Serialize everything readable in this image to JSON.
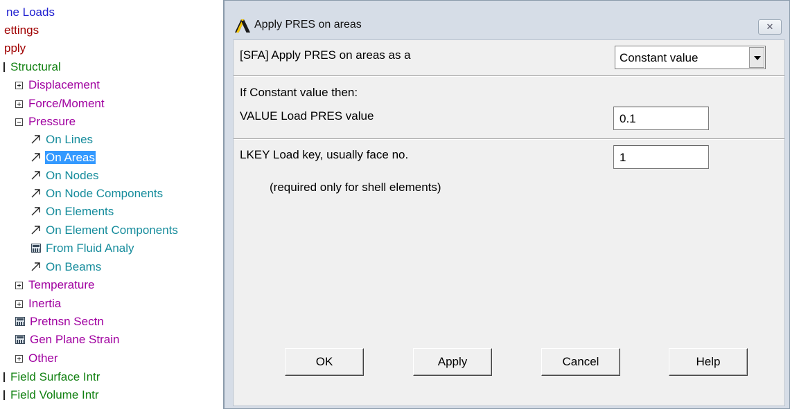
{
  "tree": {
    "items": [
      {
        "label": "ne Loads",
        "color": "#1f1fd0"
      },
      {
        "label": "ettings",
        "color": "#a00000"
      },
      {
        "label": "pply",
        "color": "#a00000"
      },
      {
        "label": "Structural",
        "color": "#108010"
      },
      {
        "label": "Displacement",
        "color": "#a000a0"
      },
      {
        "label": "Force/Moment",
        "color": "#a000a0"
      },
      {
        "label": "Pressure",
        "color": "#a000a0"
      },
      {
        "label": "On Lines",
        "color": "#168c9c"
      },
      {
        "label": "On Areas",
        "color": "#ffffff",
        "selected": true
      },
      {
        "label": "On Nodes",
        "color": "#168c9c"
      },
      {
        "label": "On Node Components",
        "color": "#168c9c"
      },
      {
        "label": "On Elements",
        "color": "#168c9c"
      },
      {
        "label": "On Element Components",
        "color": "#168c9c"
      },
      {
        "label": "From Fluid Analy",
        "color": "#168c9c"
      },
      {
        "label": "On Beams",
        "color": "#168c9c"
      },
      {
        "label": "Temperature",
        "color": "#a000a0"
      },
      {
        "label": "Inertia",
        "color": "#a000a0"
      },
      {
        "label": "Pretnsn Sectn",
        "color": "#a000a0"
      },
      {
        "label": "Gen Plane Strain",
        "color": "#a000a0"
      },
      {
        "label": "Other",
        "color": "#a000a0"
      },
      {
        "label": "Field Surface Intr",
        "color": "#108010"
      },
      {
        "label": "Field Volume Intr",
        "color": "#108010"
      }
    ]
  },
  "dialog": {
    "title": "Apply PRES on areas",
    "close_icon": "close-icon",
    "apply_as_label": "[SFA] Apply PRES on areas as a",
    "apply_as_value": "Constant value",
    "if_constant_label": "If Constant value then:",
    "value_label": "VALUE  Load PRES value",
    "value": "0.1",
    "lkey_label": "LKEY  Load key, usually face no.",
    "lkey_value": "1",
    "shell_note": "(required only for shell elements)",
    "buttons": {
      "ok": "OK",
      "apply": "Apply",
      "cancel": "Cancel",
      "help": "Help"
    }
  }
}
